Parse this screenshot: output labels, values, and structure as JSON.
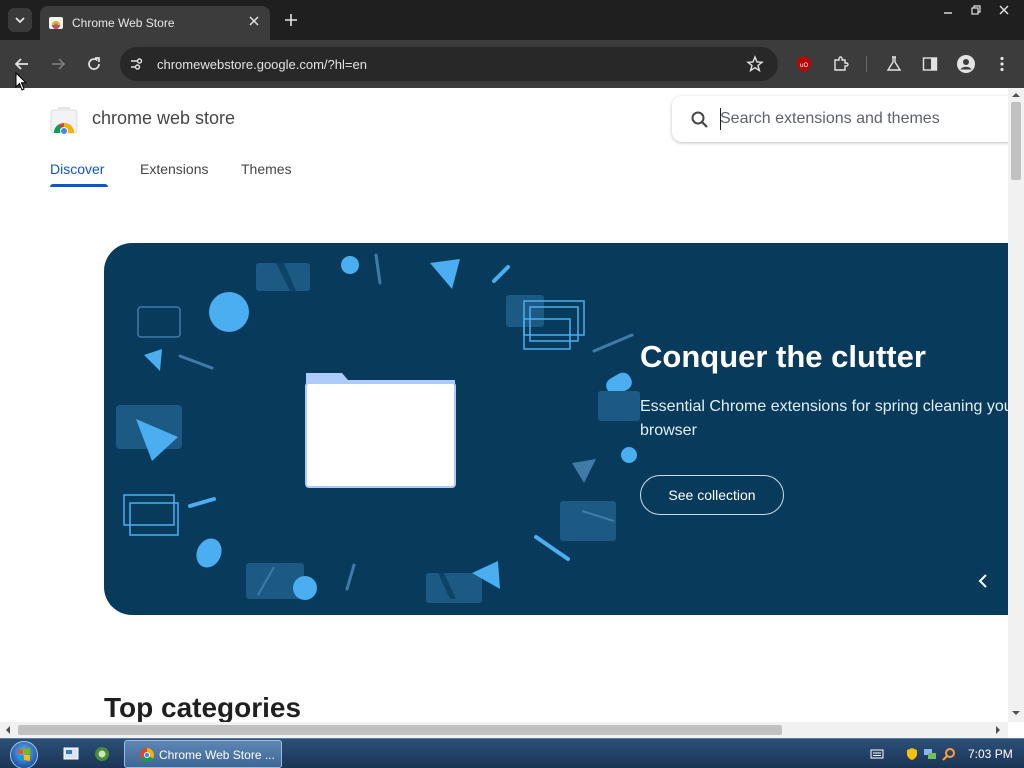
{
  "browser": {
    "tab": {
      "title": "Chrome Web Store"
    },
    "url": "chromewebstore.google.com/?hl=en"
  },
  "site": {
    "brand": "chrome web store",
    "search_placeholder": "Search extensions and themes",
    "nav": [
      {
        "label": "Discover",
        "active": true
      },
      {
        "label": "Extensions",
        "active": false
      },
      {
        "label": "Themes",
        "active": false
      }
    ],
    "hero": {
      "title": "Conquer the clutter",
      "subtitle": "Essential Chrome extensions for spring cleaning your browser",
      "button": "See collection"
    },
    "section_title": "Top categories"
  },
  "colors": {
    "hero_bg": "#083a5c",
    "accent": "#0b57d0",
    "hero_shape": "#4aaef0"
  },
  "taskbar": {
    "window_label": "Chrome Web Store ...",
    "clock": "7:03 PM"
  }
}
